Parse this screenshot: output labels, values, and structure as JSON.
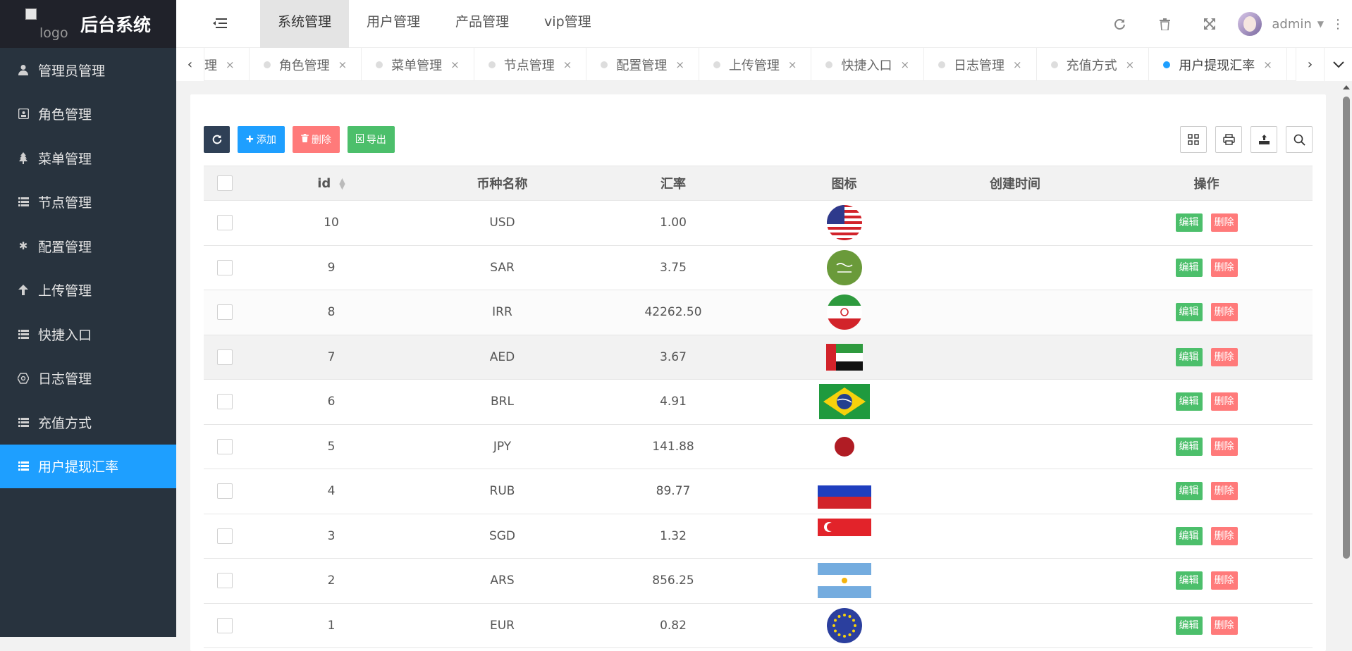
{
  "app": {
    "logo_alt": "logo",
    "title": "后台系统"
  },
  "sidebar": {
    "items": [
      {
        "label": "管理员管理",
        "icon": "user-icon"
      },
      {
        "label": "角色管理",
        "icon": "id-card-icon"
      },
      {
        "label": "菜单管理",
        "icon": "tree-icon"
      },
      {
        "label": "节点管理",
        "icon": "list-icon"
      },
      {
        "label": "配置管理",
        "icon": "asterisk-icon"
      },
      {
        "label": "上传管理",
        "icon": "arrow-up-icon"
      },
      {
        "label": "快捷入口",
        "icon": "list-icon"
      },
      {
        "label": "日志管理",
        "icon": "hexagon-icon"
      },
      {
        "label": "充值方式",
        "icon": "list-icon"
      },
      {
        "label": "用户提现汇率",
        "icon": "list-icon",
        "active": true
      }
    ]
  },
  "header": {
    "nav": [
      {
        "label": "系统管理",
        "active": true
      },
      {
        "label": "用户管理"
      },
      {
        "label": "产品管理"
      },
      {
        "label": "vip管理"
      }
    ],
    "username": "admin"
  },
  "tabs": [
    {
      "label": "理"
    },
    {
      "label": "角色管理"
    },
    {
      "label": "菜单管理"
    },
    {
      "label": "节点管理"
    },
    {
      "label": "配置管理"
    },
    {
      "label": "上传管理"
    },
    {
      "label": "快捷入口"
    },
    {
      "label": "日志管理"
    },
    {
      "label": "充值方式"
    },
    {
      "label": "用户提现汇率",
      "active": true
    }
  ],
  "toolbar": {
    "add_label": "添加",
    "delete_label": "删除",
    "export_label": "导出"
  },
  "table": {
    "columns": [
      "id",
      "币种名称",
      "汇率",
      "图标",
      "创建时间",
      "操作"
    ],
    "edit_label": "编辑",
    "delete_label": "删除",
    "rows": [
      {
        "id": "10",
        "currency": "USD",
        "rate": "1.00",
        "flag": "us-flag-icon",
        "created": ""
      },
      {
        "id": "9",
        "currency": "SAR",
        "rate": "3.75",
        "flag": "sa-flag-icon",
        "created": ""
      },
      {
        "id": "8",
        "currency": "IRR",
        "rate": "42262.50",
        "flag": "ir-flag-icon",
        "created": ""
      },
      {
        "id": "7",
        "currency": "AED",
        "rate": "3.67",
        "flag": "ae-flag-icon",
        "created": ""
      },
      {
        "id": "6",
        "currency": "BRL",
        "rate": "4.91",
        "flag": "br-flag-icon",
        "created": ""
      },
      {
        "id": "5",
        "currency": "JPY",
        "rate": "141.88",
        "flag": "jp-flag-icon",
        "created": ""
      },
      {
        "id": "4",
        "currency": "RUB",
        "rate": "89.77",
        "flag": "ru-flag-icon",
        "created": ""
      },
      {
        "id": "3",
        "currency": "SGD",
        "rate": "1.32",
        "flag": "sg-flag-icon",
        "created": ""
      },
      {
        "id": "2",
        "currency": "ARS",
        "rate": "856.25",
        "flag": "ar-flag-icon",
        "created": ""
      },
      {
        "id": "1",
        "currency": "EUR",
        "rate": "0.82",
        "flag": "eu-flag-icon",
        "created": ""
      }
    ]
  },
  "colors": {
    "sidebar_bg": "#28333e",
    "accent": "#1e9fff",
    "success": "#4cbf6b",
    "danger": "#ff7a7a"
  }
}
